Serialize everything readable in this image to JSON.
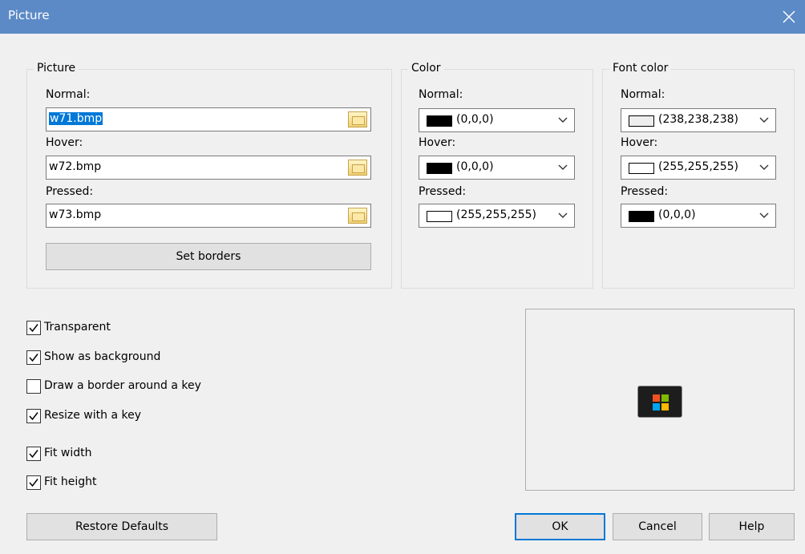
{
  "window": {
    "title": "Picture"
  },
  "picture_group": {
    "legend": "Picture",
    "normal_label": "Normal:",
    "normal_value": "w71.bmp",
    "hover_label": "Hover:",
    "hover_value": "w72.bmp",
    "pressed_label": "Pressed:",
    "pressed_value": "w73.bmp",
    "set_borders": "Set borders"
  },
  "color_group": {
    "legend": "Color",
    "normal_label": "Normal:",
    "normal_value": "(0,0,0)",
    "normal_color": "#000000",
    "hover_label": "Hover:",
    "hover_value": "(0,0,0)",
    "hover_color": "#000000",
    "pressed_label": "Pressed:",
    "pressed_value": "(255,255,255)",
    "pressed_color": "#ffffff"
  },
  "font_color_group": {
    "legend": "Font color",
    "normal_label": "Normal:",
    "normal_value": "(238,238,238)",
    "normal_color": "#eeeeee",
    "hover_label": "Hover:",
    "hover_value": "(255,255,255)",
    "hover_color": "#ffffff",
    "pressed_label": "Pressed:",
    "pressed_value": "(0,0,0)",
    "pressed_color": "#000000"
  },
  "options": [
    {
      "label": "Transparent",
      "checked": true
    },
    {
      "label": "Show as background",
      "checked": true
    },
    {
      "label": "Draw a border around a key",
      "checked": false
    },
    {
      "label": "Resize with a key",
      "checked": true
    },
    {
      "label": "Fit width",
      "checked": true
    },
    {
      "label": "Fit height",
      "checked": true
    }
  ],
  "buttons": {
    "restore": "Restore Defaults",
    "ok": "OK",
    "cancel": "Cancel",
    "help": "Help"
  },
  "icons": {
    "close": "close-icon",
    "browse": "folder-icon",
    "dropdown": "chevron-down-icon",
    "check": "checkmark-icon",
    "preview_logo": "windows-logo-icon"
  },
  "colors": {
    "titlebar": "#5b8ac6",
    "selection": "#0078d7",
    "logo_red": "#f25022",
    "logo_green": "#7fba00",
    "logo_blue": "#00a4ef",
    "logo_yellow": "#ffb900"
  }
}
